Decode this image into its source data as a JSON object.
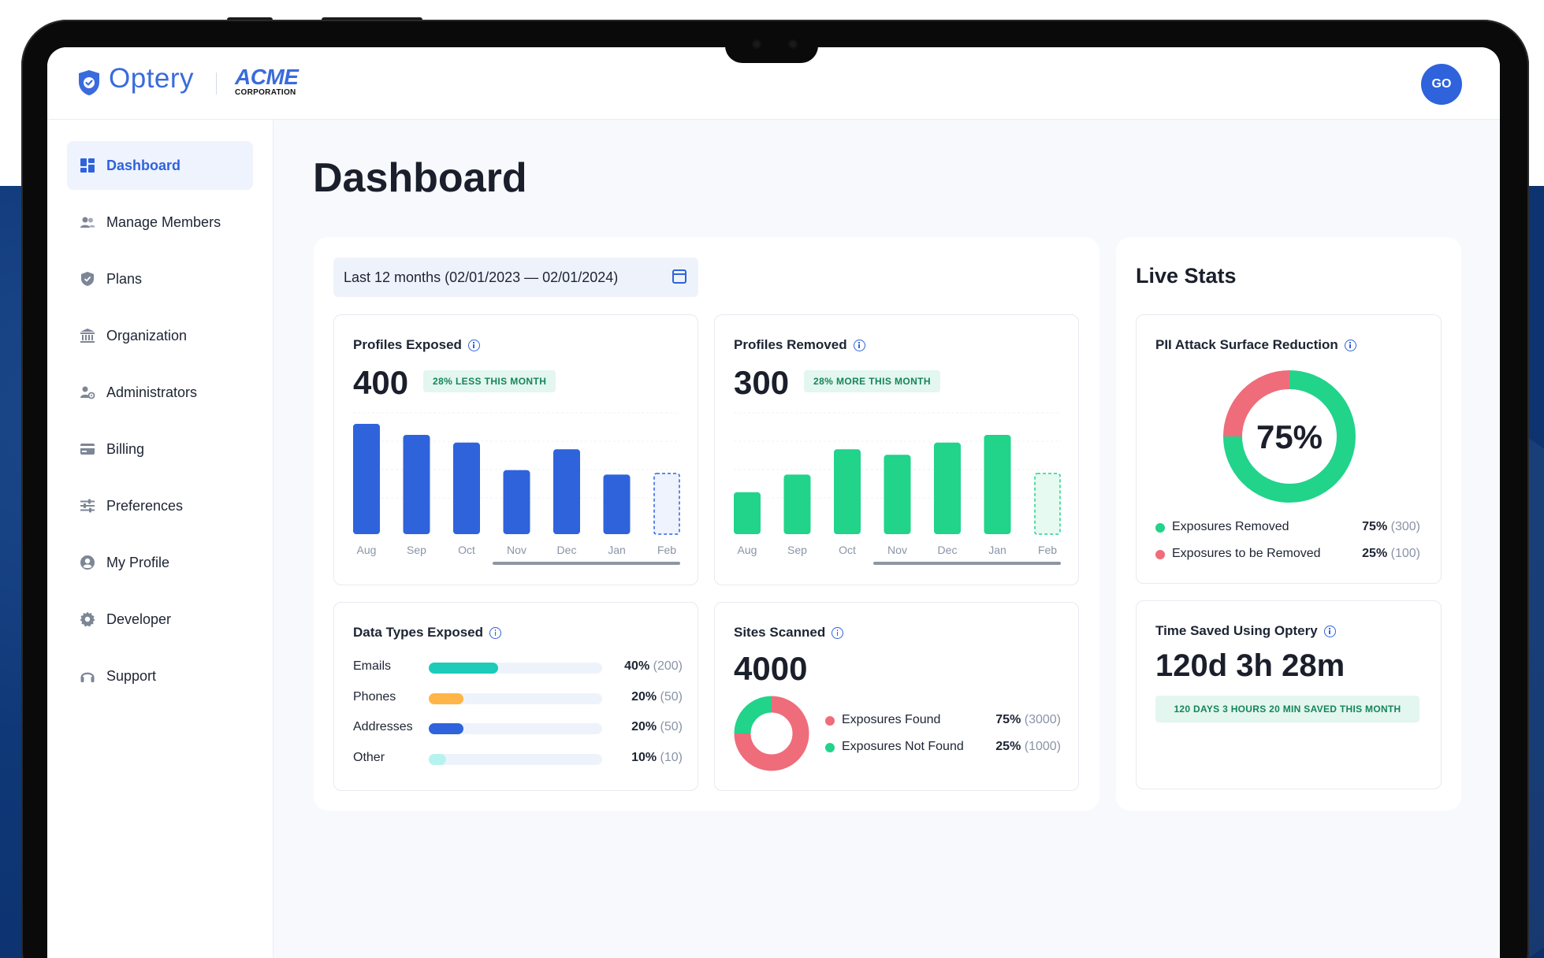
{
  "brand": {
    "name": "Optery",
    "client_name": "ACME",
    "client_sub": "CORPORATION",
    "avatar_initials": "GO"
  },
  "sidebar": {
    "items": [
      {
        "label": "Dashboard",
        "icon": "dashboard-icon",
        "active": true
      },
      {
        "label": "Manage Members",
        "icon": "members-icon"
      },
      {
        "label": "Plans",
        "icon": "shield-icon"
      },
      {
        "label": "Organization",
        "icon": "bank-icon"
      },
      {
        "label": "Administrators",
        "icon": "admin-icon"
      },
      {
        "label": "Billing",
        "icon": "card-icon"
      },
      {
        "label": "Preferences",
        "icon": "sliders-icon"
      },
      {
        "label": "My Profile",
        "icon": "user-icon"
      },
      {
        "label": "Developer",
        "icon": "gear-icon"
      },
      {
        "label": "Support",
        "icon": "headset-icon"
      }
    ]
  },
  "page": {
    "title": "Dashboard",
    "date_range": "Last 12 months (02/01/2023 — 02/01/2024)"
  },
  "colors": {
    "accent": "#2f63dc",
    "green": "#22d38a",
    "red": "#ef6c7a",
    "teal": "#1ccbb8",
    "orange": "#ffb547",
    "light_teal": "#b6f3ee"
  },
  "profiles_exposed": {
    "title": "Profiles Exposed",
    "value": "400",
    "badge": "28% LESS THIS MONTH",
    "chart_data": {
      "type": "bar",
      "categories": [
        "Aug",
        "Sep",
        "Oct",
        "Nov",
        "Dec",
        "Jan",
        "Feb"
      ],
      "values": [
        100,
        90,
        83,
        58,
        77,
        54,
        null
      ],
      "ylim": [
        0,
        100
      ]
    }
  },
  "profiles_removed": {
    "title": "Profiles Removed",
    "value": "300",
    "badge": "28% MORE THIS MONTH",
    "chart_data": {
      "type": "bar",
      "categories": [
        "Aug",
        "Sep",
        "Oct",
        "Nov",
        "Dec",
        "Jan",
        "Feb"
      ],
      "values": [
        38,
        54,
        77,
        72,
        83,
        90,
        null
      ],
      "ylim": [
        0,
        100
      ]
    }
  },
  "data_types": {
    "title": "Data Types Exposed",
    "rows": [
      {
        "name": "Emails",
        "pct": "40%",
        "count": "(200)",
        "fraction": 0.4,
        "color": "#1ccbb8"
      },
      {
        "name": "Phones",
        "pct": "20%",
        "count": "(50)",
        "fraction": 0.2,
        "color": "#ffb547"
      },
      {
        "name": "Addresses",
        "pct": "20%",
        "count": "(50)",
        "fraction": 0.2,
        "color": "#2f63dc"
      },
      {
        "name": "Other",
        "pct": "10%",
        "count": "(10)",
        "fraction": 0.1,
        "color": "#b6f3ee"
      }
    ]
  },
  "sites_scanned": {
    "title": "Sites Scanned",
    "value": "4000",
    "legend": [
      {
        "name": "Exposures Found",
        "pct": "75%",
        "count": "(3000)",
        "color": "#ef6c7a"
      },
      {
        "name": "Exposures Not Found",
        "pct": "25%",
        "count": "(1000)",
        "color": "#22d38a"
      }
    ],
    "chart_data": {
      "type": "pie",
      "values": [
        75,
        25
      ]
    }
  },
  "live_stats": {
    "title": "Live Stats",
    "pii": {
      "title": "PII Attack Surface Reduction",
      "center": "75%",
      "legend": [
        {
          "name": "Exposures Removed",
          "pct": "75%",
          "count": "(300)",
          "color": "#22d38a"
        },
        {
          "name": "Exposures to be Removed",
          "pct": "25%",
          "count": "(100)",
          "color": "#ef6c7a"
        }
      ],
      "chart_data": {
        "type": "pie",
        "values": [
          75,
          25
        ]
      }
    },
    "time_saved": {
      "title": "Time Saved Using Optery",
      "value": "120d 3h 28m",
      "badge": "120 DAYS 3 HOURS 20 MIN SAVED THIS MONTH"
    }
  }
}
